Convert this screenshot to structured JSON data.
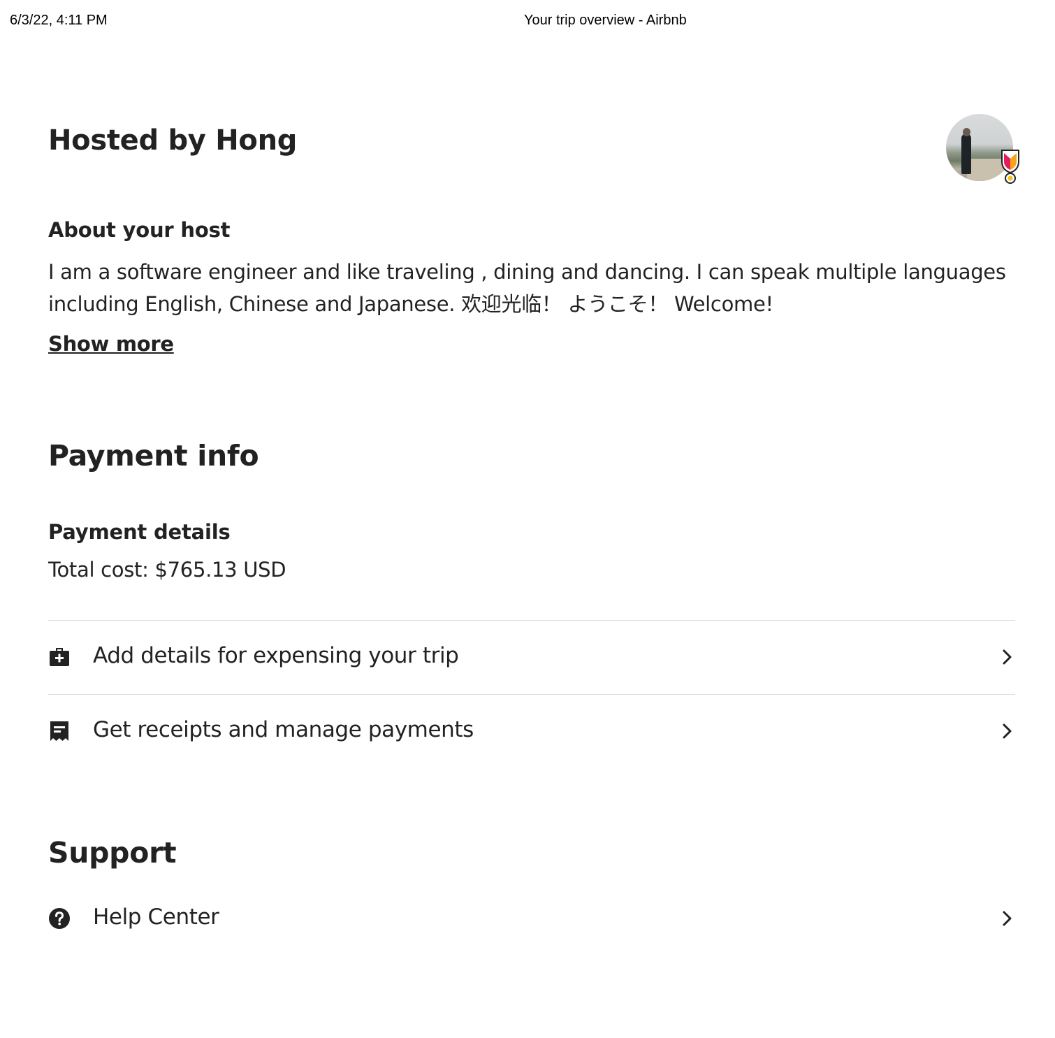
{
  "print_header": {
    "date": "6/3/22, 4:11 PM",
    "page_title": "Your trip overview - Airbnb"
  },
  "host": {
    "title": "Hosted by Hong",
    "avatar_icon": "host-avatar",
    "badge_icon": "superhost-badge-icon",
    "about_title": "About your host",
    "about_text": "I am a software engineer and like traveling , dining and dancing. I can speak multiple languages including English, Chinese and Japanese. 欢迎光临！ ようこそ！ Welcome!",
    "show_more_label": "Show more"
  },
  "payment": {
    "title": "Payment info",
    "details_title": "Payment details",
    "total_cost": "Total cost: $765.13 USD",
    "rows": [
      {
        "icon": "briefcase-plus-icon",
        "label": "Add details for expensing your trip"
      },
      {
        "icon": "receipt-icon",
        "label": "Get receipts and manage payments"
      }
    ]
  },
  "support": {
    "title": "Support",
    "rows": [
      {
        "icon": "help-circle-icon",
        "label": "Help Center"
      }
    ]
  },
  "colors": {
    "text": "#222222",
    "divider": "#dddddd",
    "badge_red": "#e31c5f",
    "badge_orange": "#f7a21b"
  }
}
